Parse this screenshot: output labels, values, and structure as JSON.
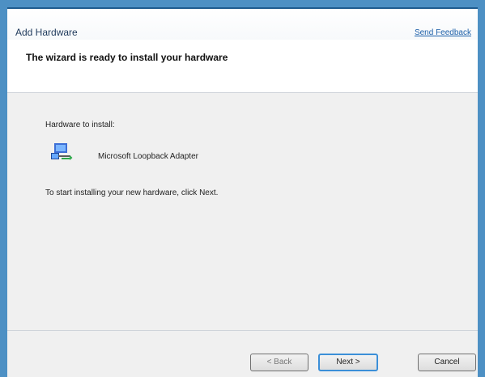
{
  "window": {
    "title": "Add Hardware",
    "feedback_link": "Send Feedback"
  },
  "header": {
    "heading": "The wizard is ready to install your hardware"
  },
  "content": {
    "hardware_label": "Hardware to install:",
    "device_name": "Microsoft Loopback Adapter",
    "instruction": "To start installing your new hardware, click Next."
  },
  "footer": {
    "back_label": "< Back",
    "next_label": "Next >",
    "cancel_label": "Cancel"
  },
  "icons": {
    "device": "network-adapter-icon"
  }
}
